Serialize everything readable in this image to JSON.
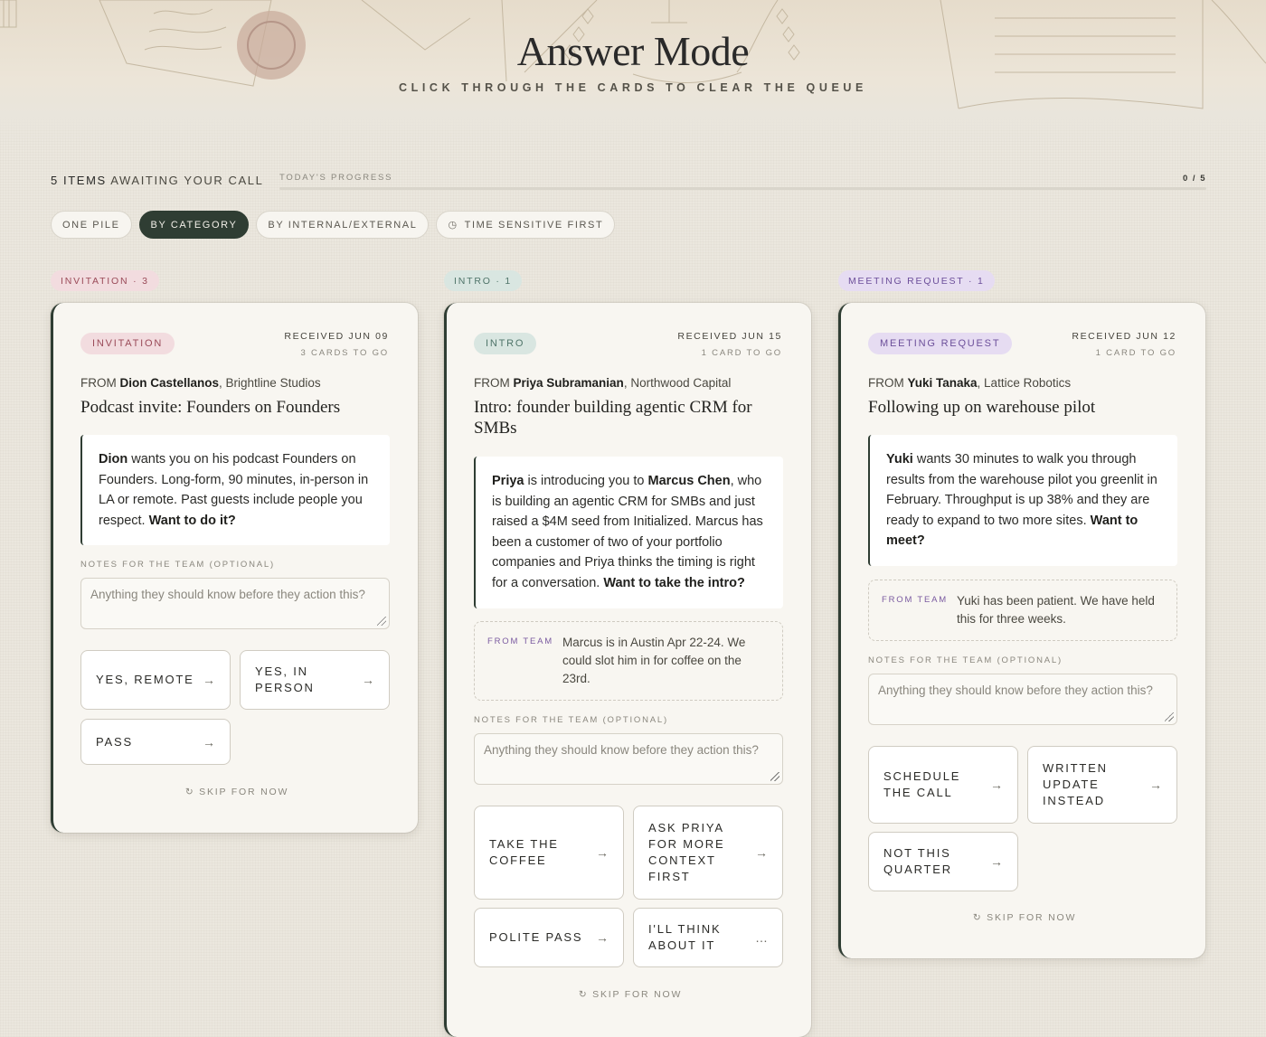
{
  "header": {
    "title": "Answer Mode",
    "subtitle": "CLICK THROUGH THE CARDS TO CLEAR THE QUEUE"
  },
  "status": {
    "count": "5 ITEMS",
    "suffix": " AWAITING YOUR CALL",
    "progress_label": "TODAY'S PROGRESS",
    "progress_count": "0 / 5",
    "progress_fraction": 0
  },
  "filters": [
    {
      "label": "ONE PILE",
      "active": false
    },
    {
      "label": "BY CATEGORY",
      "active": true
    },
    {
      "label": "BY INTERNAL/EXTERNAL",
      "active": false
    },
    {
      "label": "TIME SENSITIVE FIRST",
      "active": false,
      "icon": "clock-icon"
    }
  ],
  "columns": [
    {
      "tag": "INVITATION · 3",
      "card": {
        "badge": "INVITATION",
        "received": "RECEIVED JUN 09",
        "togo": "3 CARDS TO GO",
        "from_prefix": "FROM ",
        "from_name": "Dion Castellanos",
        "from_org": ", Brightline Studios",
        "subject": "Podcast invite: Founders on Founders",
        "body_name": "Dion",
        "body_text": " wants you on his podcast Founders on Founders. Long-form, 90 minutes, in-person in LA or remote. Past guests include people you respect. ",
        "body_ask": "Want to do it?",
        "notes_label": "NOTES FOR THE TEAM (OPTIONAL)",
        "notes_placeholder": "Anything they should know before they action this?",
        "actions": [
          {
            "label": "YES, REMOTE",
            "icon": "→"
          },
          {
            "label": "YES, IN PERSON",
            "icon": "→"
          },
          {
            "label": "PASS",
            "icon": "→"
          }
        ],
        "skip": "SKIP FOR NOW"
      }
    },
    {
      "tag": "INTRO · 1",
      "card": {
        "badge": "INTRO",
        "received": "RECEIVED JUN 15",
        "togo": "1 CARD TO GO",
        "from_prefix": "FROM ",
        "from_name": "Priya Subramanian",
        "from_org": ", Northwood Capital",
        "subject": "Intro: founder building agentic CRM for SMBs",
        "body_name": "Priya",
        "body_mid1": " is introducing you to ",
        "body_name2": "Marcus Chen",
        "body_text": ", who is building an agentic CRM for SMBs and just raised a $4M seed from Initialized. Marcus has been a customer of two of your portfolio companies and Priya thinks the timing is right for a conversation. ",
        "body_ask": "Want to take the intro?",
        "team_label": "FROM TEAM",
        "team_text": "Marcus is in Austin Apr 22-24. We could slot him in for coffee on the 23rd.",
        "notes_label": "NOTES FOR THE TEAM (OPTIONAL)",
        "notes_placeholder": "Anything they should know before they action this?",
        "actions": [
          {
            "label": "TAKE THE COFFEE",
            "icon": "→"
          },
          {
            "label": "ASK PRIYA FOR MORE CONTEXT FIRST",
            "icon": "→"
          },
          {
            "label": "POLITE PASS",
            "icon": "→"
          },
          {
            "label": "I'LL THINK ABOUT IT",
            "icon": "…"
          }
        ],
        "skip": "SKIP FOR NOW"
      }
    },
    {
      "tag": "MEETING REQUEST · 1",
      "card": {
        "badge": "MEETING REQUEST",
        "received": "RECEIVED JUN 12",
        "togo": "1 CARD TO GO",
        "from_prefix": "FROM ",
        "from_name": "Yuki Tanaka",
        "from_org": ", Lattice Robotics",
        "subject": "Following up on warehouse pilot",
        "body_name": "Yuki",
        "body_text": " wants 30 minutes to walk you through results from the warehouse pilot you greenlit in February. Throughput is up 38% and they are ready to expand to two more sites. ",
        "body_ask": "Want to meet?",
        "team_label": "FROM TEAM",
        "team_text": "Yuki has been patient. We have held this for three weeks.",
        "notes_label": "NOTES FOR THE TEAM (OPTIONAL)",
        "notes_placeholder": "Anything they should know before they action this?",
        "actions": [
          {
            "label": "SCHEDULE THE CALL",
            "icon": "→"
          },
          {
            "label": "WRITTEN UPDATE INSTEAD",
            "icon": "→"
          },
          {
            "label": "NOT THIS QUARTER",
            "icon": "→"
          }
        ],
        "skip": "SKIP FOR NOW"
      }
    }
  ],
  "colors": {
    "accent": "#2f3d33",
    "invitation": "#f2dcdf",
    "intro": "#d9e6e1",
    "meeting": "#e6dcf2"
  }
}
